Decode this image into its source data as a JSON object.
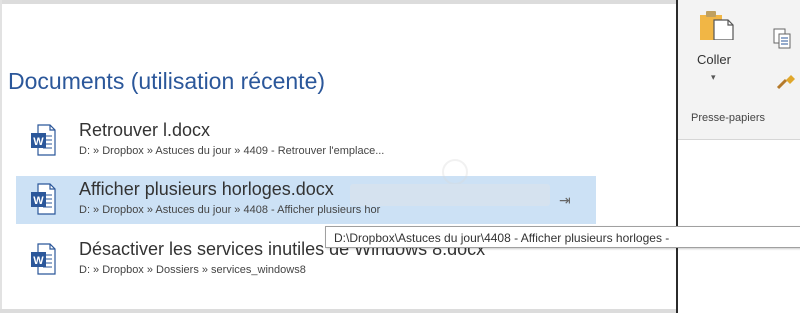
{
  "recent_documents": {
    "title": "Documents (utilisation récente)",
    "items": [
      {
        "name": "Retrouver l.docx",
        "path": "D: » Dropbox » Astuces du jour » 4409 - Retrouver l'emplace..."
      },
      {
        "name": "Afficher plusieurs horloges.docx",
        "path": "D: » Dropbox » Astuces du jour » 4408 - Afficher plusieurs hor",
        "selected": true
      },
      {
        "name": "Désactiver les services inutiles de Windows 8.docx",
        "path": "D: » Dropbox » Dossiers » services_windows8"
      }
    ]
  },
  "tooltip": {
    "text": "D:\\Dropbox\\Astuces du jour\\4408 - Afficher plusieurs horloges -"
  },
  "ribbon": {
    "paste_label": "Coller",
    "paste_arrow": "▾",
    "group_label": "Presse-papiers"
  },
  "icons": {
    "word_doc": "word-document-icon",
    "pin": "pin-icon",
    "paste": "paste-icon",
    "copy": "copy-icon",
    "format_painter": "format-painter-icon"
  },
  "colors": {
    "title_blue": "#2b579a",
    "word_blue": "#2b579a",
    "selected_row": "#cce1f5"
  }
}
